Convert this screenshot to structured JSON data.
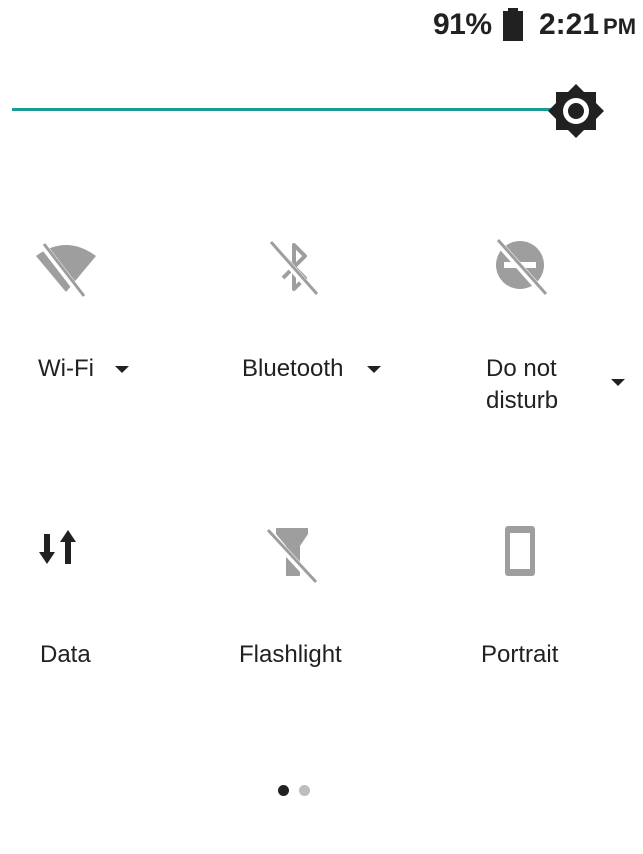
{
  "status_bar": {
    "battery_percent": "91%",
    "time": "2:21",
    "ampm": "PM",
    "battery_icon": "battery-icon"
  },
  "brightness": {
    "level": 0.95,
    "accent_color": "#1a9b96",
    "icon": "brightness-icon"
  },
  "tiles": [
    {
      "label": "Wi-Fi",
      "icon": "wifi-off-icon",
      "has_dropdown": true,
      "state": "off"
    },
    {
      "label": "Bluetooth",
      "icon": "bluetooth-off-icon",
      "has_dropdown": true,
      "state": "off"
    },
    {
      "label_line1": "Do not",
      "label_line2": "disturb",
      "icon": "do-not-disturb-off-icon",
      "has_dropdown": true,
      "state": "off"
    },
    {
      "label": "Data",
      "icon": "data-arrows-icon",
      "has_dropdown": false,
      "state": "on"
    },
    {
      "label": "Flashlight",
      "icon": "flashlight-off-icon",
      "has_dropdown": false,
      "state": "off"
    },
    {
      "label": "Portrait",
      "icon": "portrait-icon",
      "has_dropdown": false,
      "state": "off"
    }
  ],
  "pagination": {
    "pages": 2,
    "current": 1
  },
  "colors": {
    "icon_off": "#9e9e9e",
    "icon_on": "#212121",
    "dot_active": "#212121",
    "dot_inactive": "#bdbdbd"
  }
}
